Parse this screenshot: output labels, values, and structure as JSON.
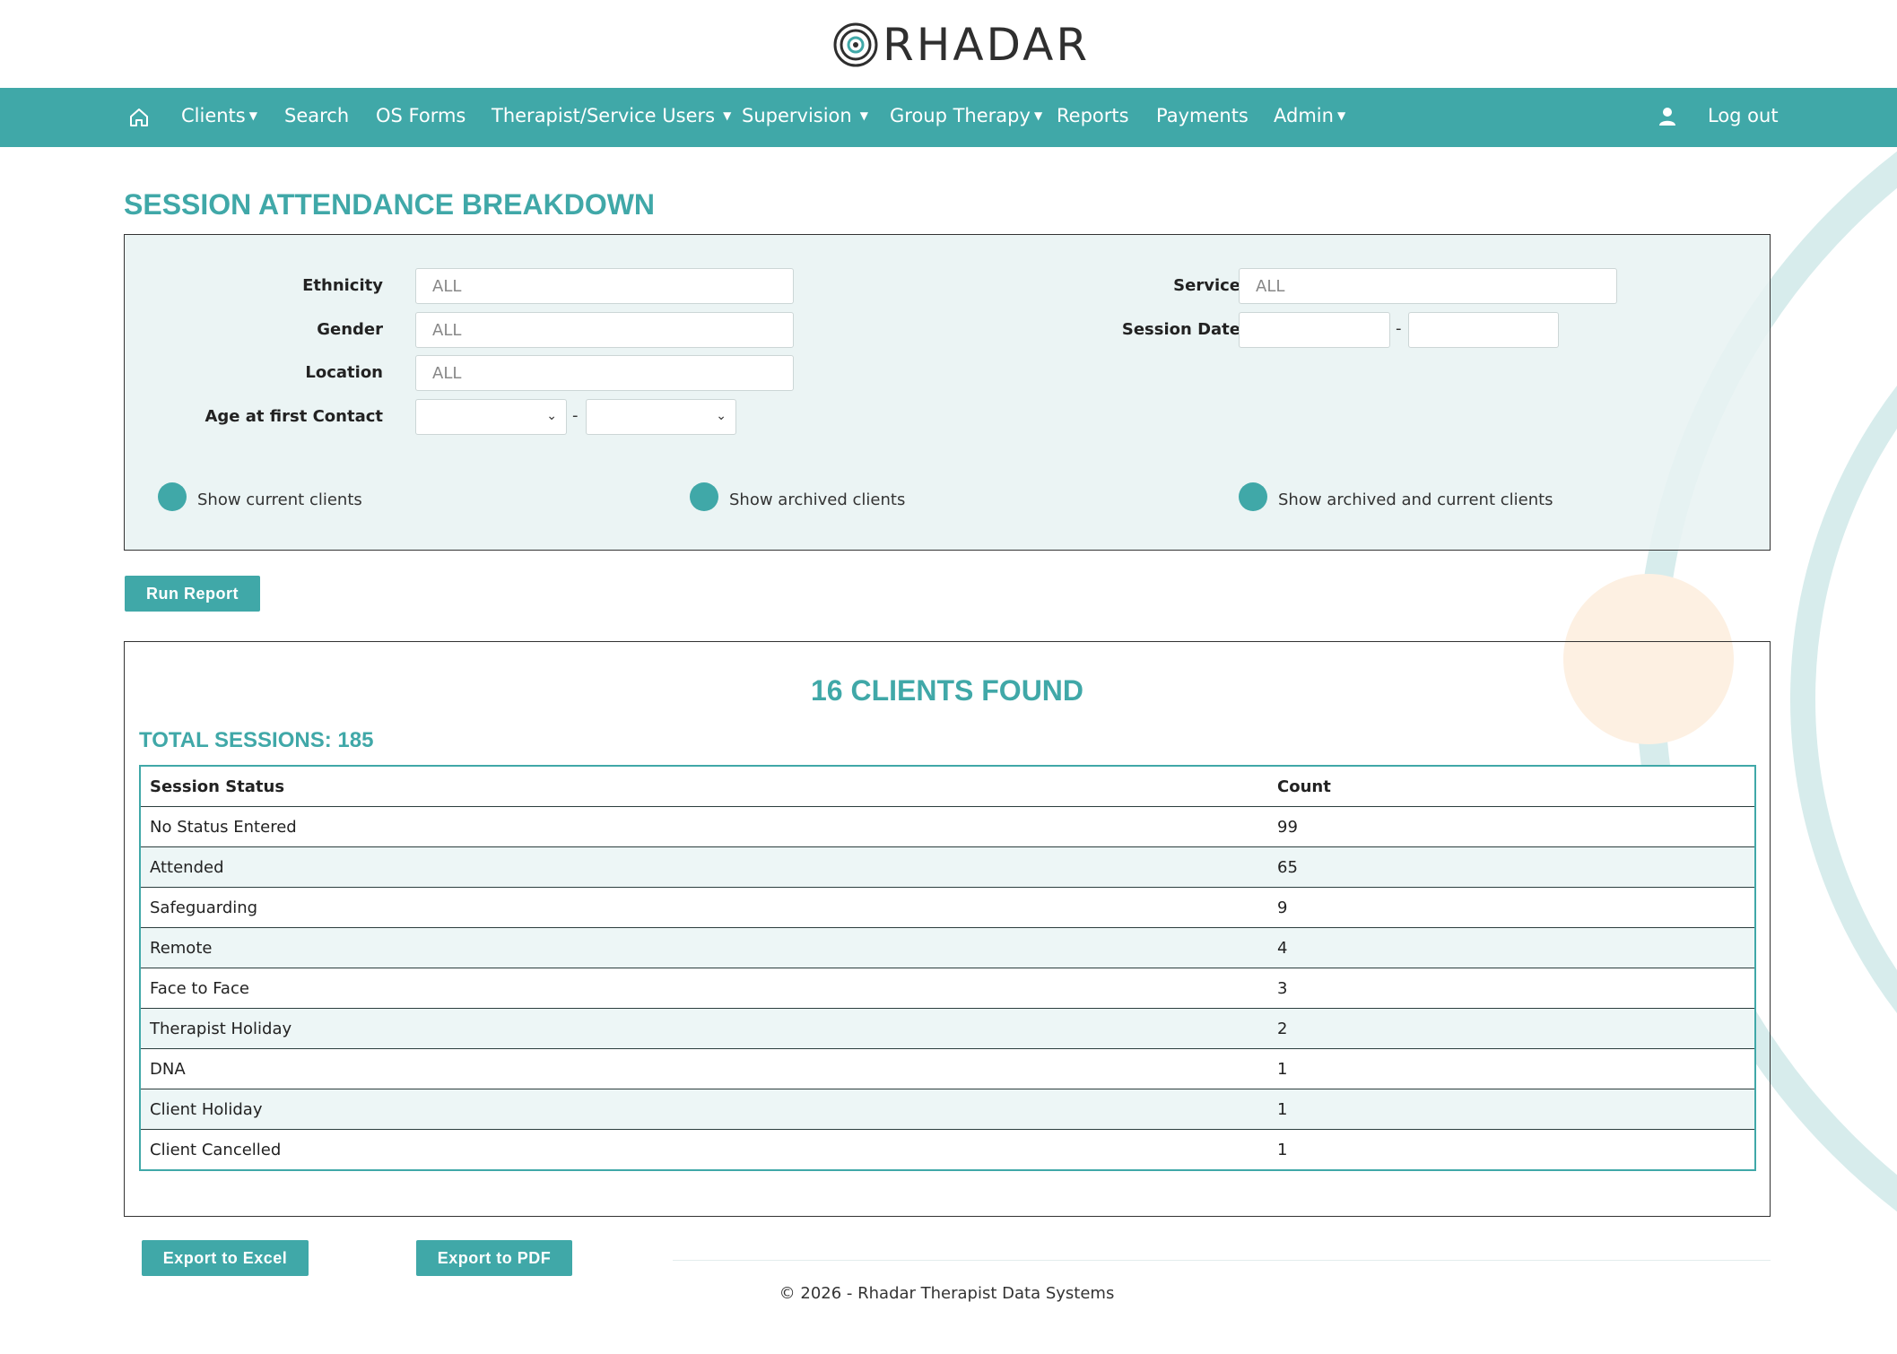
{
  "brand": {
    "name": "RHADAR",
    "teal": "#40a8a8",
    "peach": "#fdf0e2"
  },
  "nav": {
    "home_icon": "home-icon",
    "items": [
      {
        "label": "Clients",
        "caret": true
      },
      {
        "label": "Search",
        "caret": false
      },
      {
        "label": "OS Forms",
        "caret": false
      },
      {
        "label": "Therapist/Service Users",
        "caret": true
      },
      {
        "label": "Supervision",
        "caret": true
      },
      {
        "label": "Group Therapy",
        "caret": true
      },
      {
        "label": "Reports",
        "caret": false
      },
      {
        "label": "Payments",
        "caret": false
      },
      {
        "label": "Admin",
        "caret": true
      }
    ],
    "user_icon": "user-icon",
    "logout_label": "Log out"
  },
  "page": {
    "title": "SESSION ATTENDANCE BREAKDOWN"
  },
  "filters": {
    "ethnicity": {
      "label": "Ethnicity",
      "value": "ALL"
    },
    "gender": {
      "label": "Gender",
      "value": "ALL"
    },
    "location": {
      "label": "Location",
      "value": "ALL"
    },
    "age": {
      "label": "Age at first Contact",
      "from": "",
      "to": "",
      "separator": "-"
    },
    "service": {
      "label": "Service",
      "value": "ALL"
    },
    "session_date": {
      "label": "Session Date",
      "from": "",
      "to": "",
      "separator": "-"
    },
    "radios": [
      {
        "label": "Show current clients"
      },
      {
        "label": "Show archived clients"
      },
      {
        "label": "Show archived and current clients"
      }
    ]
  },
  "actions": {
    "run_report": "Run Report",
    "export_excel": "Export to Excel",
    "export_pdf": "Export to PDF"
  },
  "results": {
    "clients_found": "16 CLIENTS FOUND",
    "total_sessions_label": "TOTAL SESSIONS: 185",
    "columns": [
      "Session Status",
      "Count"
    ],
    "rows": [
      {
        "status": "No Status Entered",
        "count": "99"
      },
      {
        "status": "Attended",
        "count": "65"
      },
      {
        "status": "Safeguarding",
        "count": "9"
      },
      {
        "status": "Remote",
        "count": "4"
      },
      {
        "status": "Face to Face",
        "count": "3"
      },
      {
        "status": "Therapist Holiday",
        "count": "2"
      },
      {
        "status": "DNA",
        "count": "1"
      },
      {
        "status": "Client Holiday",
        "count": "1"
      },
      {
        "status": "Client Cancelled",
        "count": "1"
      }
    ]
  },
  "footer": {
    "text": "© 2026 - Rhadar Therapist Data Systems"
  }
}
